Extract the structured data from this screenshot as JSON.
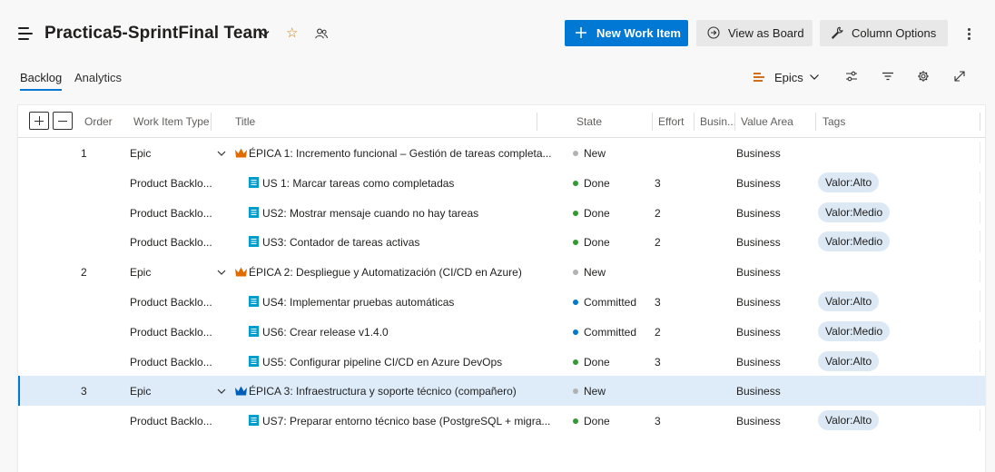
{
  "header": {
    "title": "Practica5-SprintFinal Team",
    "buttons": {
      "new_work_item": "New Work Item",
      "view_as_board": "View as Board",
      "column_options": "Column Options"
    }
  },
  "tabs": [
    {
      "label": "Backlog",
      "selected": true
    },
    {
      "label": "Analytics",
      "selected": false
    }
  ],
  "view_toolbar": {
    "backlog_level": "Epics"
  },
  "grid": {
    "columns": {
      "order": "Order",
      "work_item_type": "Work Item Type",
      "title": "Title",
      "state": "State",
      "effort": "Effort",
      "business_value": "Busin...",
      "value_area": "Value Area",
      "tags": "Tags"
    },
    "rows": [
      {
        "order": "1",
        "type": "Epic",
        "title": "ÉPICA 1: Incremento funcional – Gestión de tareas completa...",
        "state": "New",
        "effort": "",
        "value_area": "Business",
        "tag": "",
        "kind": "epic"
      },
      {
        "order": "",
        "type": "Product Backlo...",
        "title": "US 1: Marcar tareas como completadas",
        "state": "Done",
        "effort": "3",
        "value_area": "Business",
        "tag": "Valor:Alto",
        "kind": "story"
      },
      {
        "order": "",
        "type": "Product Backlo...",
        "title": "US2: Mostrar mensaje cuando no hay tareas",
        "state": "Done",
        "effort": "2",
        "value_area": "Business",
        "tag": "Valor:Medio",
        "kind": "story"
      },
      {
        "order": "",
        "type": "Product Backlo...",
        "title": "US3: Contador de tareas activas",
        "state": "Done",
        "effort": "2",
        "value_area": "Business",
        "tag": "Valor:Medio",
        "kind": "story"
      },
      {
        "order": "2",
        "type": "Epic",
        "title": "ÉPICA 2: Despliegue y Automatización (CI/CD en Azure)",
        "state": "New",
        "effort": "",
        "value_area": "Business",
        "tag": "",
        "kind": "epic"
      },
      {
        "order": "",
        "type": "Product Backlo...",
        "title": "US4: Implementar pruebas automáticas",
        "state": "Committed",
        "effort": "3",
        "value_area": "Business",
        "tag": "Valor:Alto",
        "kind": "story"
      },
      {
        "order": "",
        "type": "Product Backlo...",
        "title": "US6: Crear release v1.4.0",
        "state": "Committed",
        "effort": "2",
        "value_area": "Business",
        "tag": "Valor:Medio",
        "kind": "story"
      },
      {
        "order": "",
        "type": "Product Backlo...",
        "title": "US5: Configurar pipeline CI/CD en Azure DevOps",
        "state": "Done",
        "effort": "3",
        "value_area": "Business",
        "tag": "Valor:Alto",
        "kind": "story"
      },
      {
        "order": "3",
        "type": "Epic",
        "title": "ÉPICA 3: Infraestructura y soporte técnico (compañero)",
        "state": "New",
        "effort": "",
        "value_area": "Business",
        "tag": "",
        "kind": "epic",
        "selected": true
      },
      {
        "order": "",
        "type": "Product Backlo...",
        "title": "US7: Preparar entorno técnico base (PostgreSQL + migra...",
        "state": "Done",
        "effort": "3",
        "value_area": "Business",
        "tag": "Valor:Alto",
        "kind": "story"
      }
    ]
  },
  "colors": {
    "accent": "#0078d4",
    "state_new": "#b2b2b2",
    "state_done": "#339933",
    "state_committed": "#007acc",
    "epic_crown": "#e06c00",
    "epic_crown_selected": "#005eb8",
    "story_icon": "#009ccc",
    "tag_bg": "#dce9f5"
  },
  "icons": {
    "menu": "hamburger-menu-icon",
    "favorite": "star-outline-icon",
    "team_members": "people-icon",
    "new_item": "plus-icon",
    "board": "arrow-circle-icon",
    "column_options": "wrench-icon",
    "more": "more-vertical-icon",
    "filter_options": "sliders-icon",
    "filter": "filter-icon",
    "settings": "gear-icon",
    "fullscreen": "expand-icon"
  }
}
